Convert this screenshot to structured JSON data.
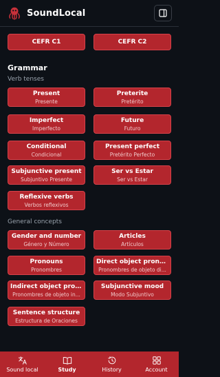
{
  "app": {
    "title": "SoundLocal"
  },
  "levels": [
    "CEFR C1",
    "CEFR C2"
  ],
  "grammar": {
    "title": "Grammar",
    "verb_tenses": {
      "title": "Verb tenses",
      "items": [
        {
          "label": "Present",
          "sub": "Presente"
        },
        {
          "label": "Preterite",
          "sub": "Pretérito"
        },
        {
          "label": "Imperfect",
          "sub": "Imperfecto"
        },
        {
          "label": "Future",
          "sub": "Futuro"
        },
        {
          "label": "Conditional",
          "sub": "Condicional"
        },
        {
          "label": "Present perfect",
          "sub": "Pretérito Perfecto"
        },
        {
          "label": "Subjunctive present",
          "sub": "Subjuntivo Presente"
        },
        {
          "label": "Ser vs Estar",
          "sub": "Ser vs Estar"
        },
        {
          "label": "Reflexive verbs",
          "sub": "Verbos reflexivos"
        }
      ]
    },
    "general": {
      "title": "General concepts",
      "items": [
        {
          "label": "Gender and number",
          "sub": "Género y Número"
        },
        {
          "label": "Articles",
          "sub": "Artículos"
        },
        {
          "label": "Pronouns",
          "sub": "Pronombres"
        },
        {
          "label": "Direct object pronouns",
          "sub": "Pronombres de objeto di..."
        },
        {
          "label": "Indirect object prono...",
          "sub": "Pronombres de objeto in..."
        },
        {
          "label": "Subjunctive mood",
          "sub": "Modo Subjuntivo"
        },
        {
          "label": "Sentence structure",
          "sub": "Estructura de Oraciones"
        }
      ]
    }
  },
  "nav": {
    "items": [
      {
        "label": "Sound local",
        "icon": "translate-icon"
      },
      {
        "label": "Study",
        "icon": "book-icon",
        "active": true
      },
      {
        "label": "History",
        "icon": "history-icon"
      },
      {
        "label": "Account",
        "icon": "grid-icon"
      }
    ]
  },
  "colors": {
    "accent": "#b3262d",
    "background": "#0d1117",
    "subtext": "#f1c9cb"
  }
}
